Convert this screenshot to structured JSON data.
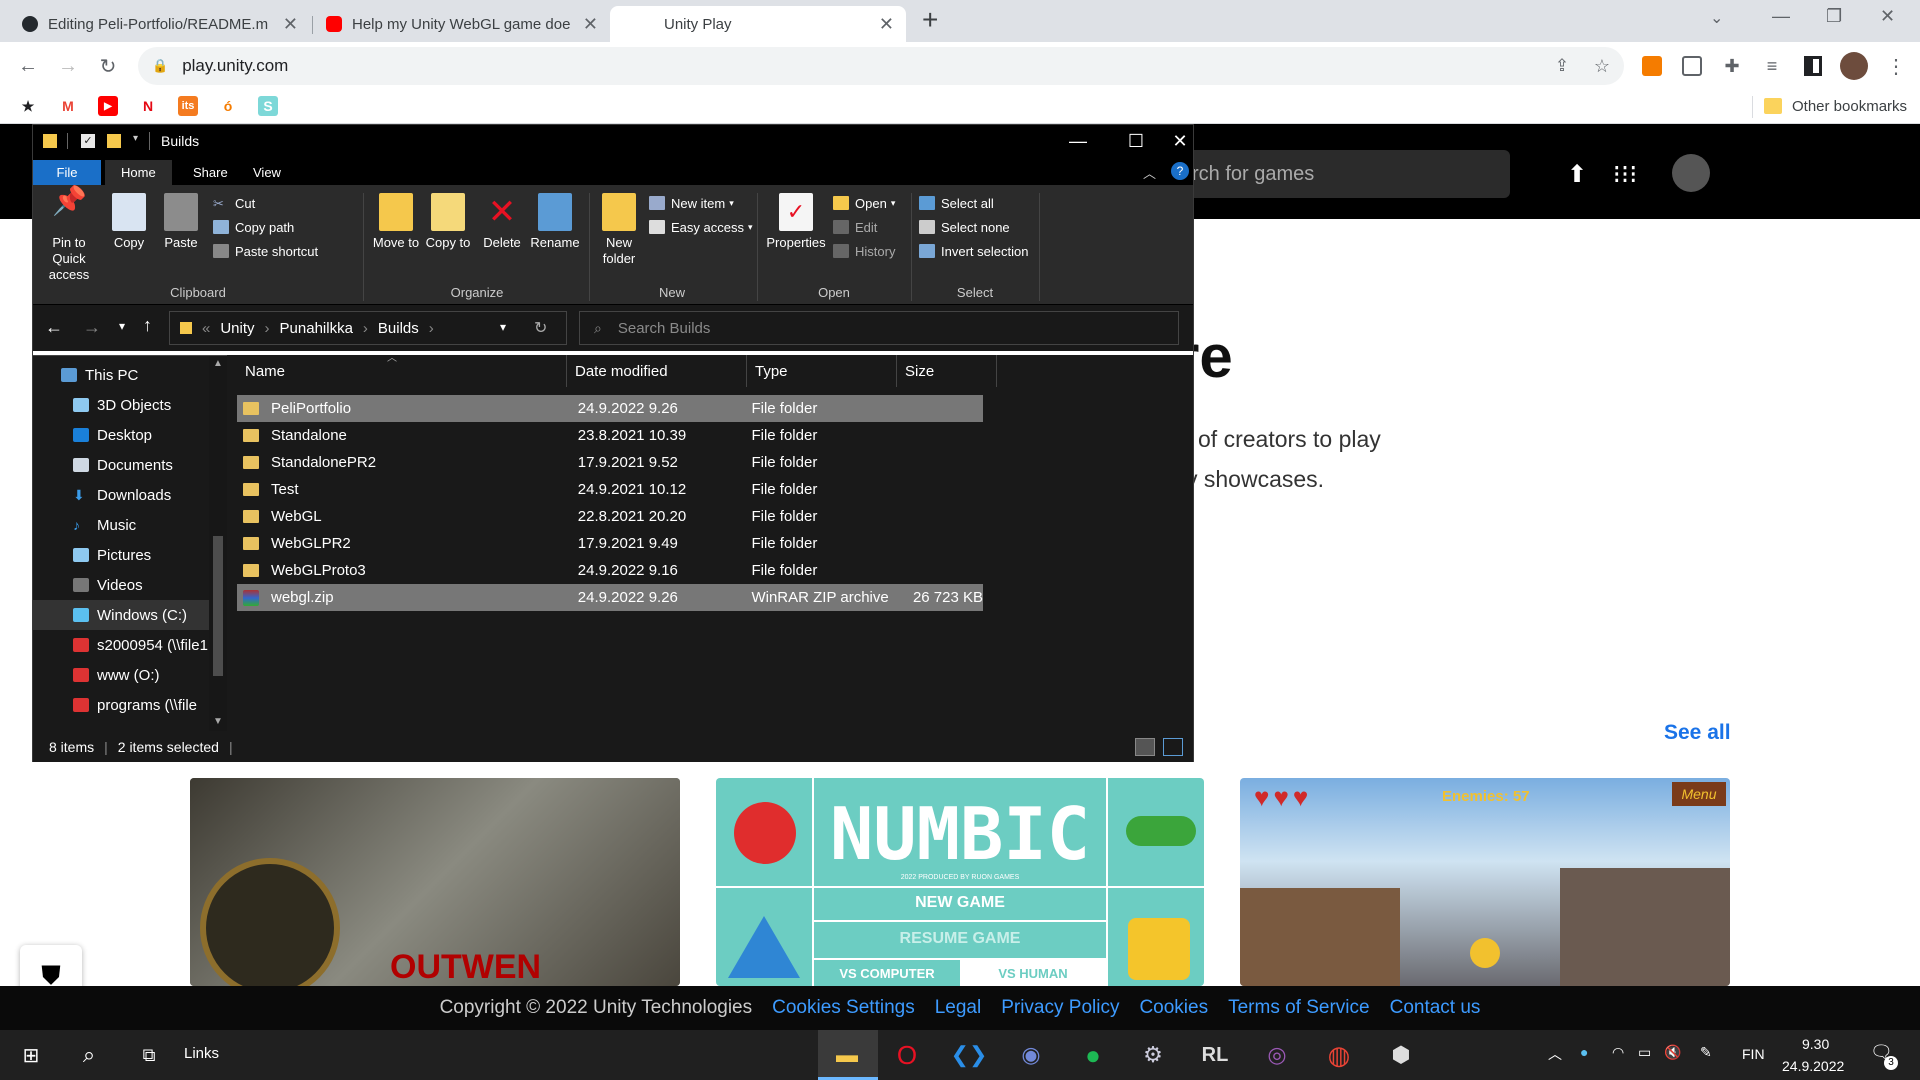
{
  "browser": {
    "tabs": [
      {
        "title": "Editing Peli-Portfolio/README.m",
        "close": "✕"
      },
      {
        "title": "Help my Unity WebGL game doe",
        "close": "✕"
      },
      {
        "title": "Unity Play",
        "close": "✕"
      }
    ],
    "new_tab": "+",
    "url": "play.unity.com",
    "bookmarks_other": "Other bookmarks"
  },
  "unity": {
    "search_placeholder": "rch for games",
    "heading": "re",
    "line1": "of creators to play",
    "line2": "y showcases.",
    "see_all": "See all",
    "card_numbic": {
      "title": "NUMBIC",
      "sub": "2022 PRODUCED BY RUON GAMES",
      "new_game": "NEW GAME",
      "resume": "RESUME GAME",
      "vs_computer": "VS COMPUTER",
      "vs_human": "VS HUMAN"
    },
    "card_rpg": {
      "text": "OUTWEN"
    },
    "card_hearts": {
      "enemies": "Enemies: 57",
      "menu": "Menu"
    },
    "footer": {
      "copyright": "Copyright © 2022 Unity Technologies",
      "links": [
        "Cookies Settings",
        "Legal",
        "Privacy Policy",
        "Cookies",
        "Terms of Service",
        "Contact us"
      ]
    }
  },
  "explorer": {
    "title": "Builds",
    "ribbon_tabs": [
      "File",
      "Home",
      "Share",
      "View"
    ],
    "clipboard": {
      "pin": "Pin to Quick access",
      "copy": "Copy",
      "paste": "Paste",
      "cut": "Cut",
      "copy_path": "Copy path",
      "paste_shortcut": "Paste shortcut",
      "label": "Clipboard"
    },
    "organize": {
      "move_to": "Move to",
      "copy_to": "Copy to",
      "delete": "Delete",
      "rename": "Rename",
      "label": "Organize"
    },
    "new": {
      "new_folder": "New folder",
      "new_item": "New item",
      "easy_access": "Easy access",
      "label": "New"
    },
    "open": {
      "properties": "Properties",
      "open": "Open",
      "edit": "Edit",
      "history": "History",
      "label": "Open"
    },
    "select": {
      "select_all": "Select all",
      "select_none": "Select none",
      "invert": "Invert selection",
      "label": "Select"
    },
    "path": [
      "Unity",
      "Punahilkka",
      "Builds"
    ],
    "search_placeholder": "Search Builds",
    "nav": [
      "This PC",
      "3D Objects",
      "Desktop",
      "Documents",
      "Downloads",
      "Music",
      "Pictures",
      "Videos",
      "Windows (C:)",
      "s2000954 (\\\\file1",
      "www (O:)",
      "programs (\\\\file"
    ],
    "columns": [
      "Name",
      "Date modified",
      "Type",
      "Size"
    ],
    "files": [
      {
        "name": "PeliPortfolio",
        "date": "24.9.2022 9.26",
        "type": "File folder",
        "size": "",
        "selected": true
      },
      {
        "name": "Standalone",
        "date": "23.8.2021 10.39",
        "type": "File folder",
        "size": "",
        "selected": false
      },
      {
        "name": "StandalonePR2",
        "date": "17.9.2021 9.52",
        "type": "File folder",
        "size": "",
        "selected": false
      },
      {
        "name": "Test",
        "date": "24.9.2021 10.12",
        "type": "File folder",
        "size": "",
        "selected": false
      },
      {
        "name": "WebGL",
        "date": "22.8.2021 20.20",
        "type": "File folder",
        "size": "",
        "selected": false
      },
      {
        "name": "WebGLPR2",
        "date": "17.9.2021 9.49",
        "type": "File folder",
        "size": "",
        "selected": false
      },
      {
        "name": "WebGLProto3",
        "date": "24.9.2022 9.16",
        "type": "File folder",
        "size": "",
        "selected": false
      },
      {
        "name": "webgl.zip",
        "date": "24.9.2022 9.26",
        "type": "WinRAR ZIP archive",
        "size": "26 723 KB",
        "selected": true
      }
    ],
    "status_items": "8 items",
    "status_selected": "2 items selected"
  },
  "taskbar": {
    "links": "Links",
    "lang": "FIN",
    "time": "9.30",
    "date": "24.9.2022",
    "notif": "3"
  }
}
